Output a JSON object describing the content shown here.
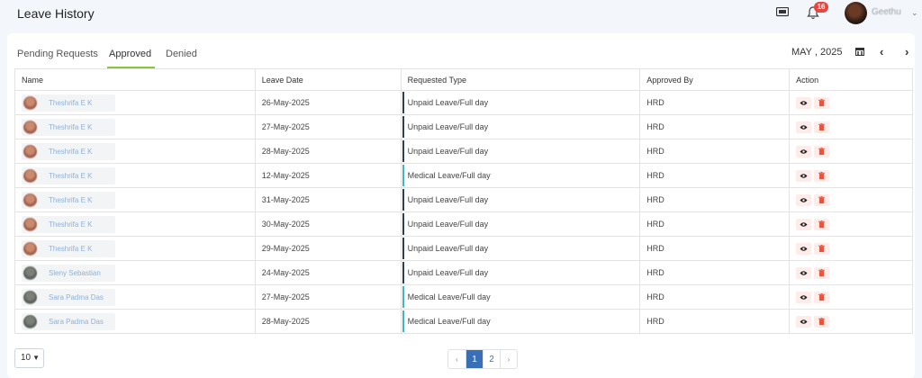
{
  "header": {
    "title": "Leave History",
    "notification_count": "16",
    "user_name": "Geethu"
  },
  "tabs": [
    {
      "label": "Pending Requests",
      "active": false
    },
    {
      "label": "Approved",
      "active": true
    },
    {
      "label": "Denied",
      "active": false
    }
  ],
  "period": {
    "label": "MAY , 2025"
  },
  "table": {
    "columns": [
      "Name",
      "Leave Date",
      "Requested Type",
      "Approved By",
      "Action"
    ],
    "rows": [
      {
        "name": "Theshrifa E K",
        "date": "26-May-2025",
        "type": "Unpaid Leave/Full day",
        "approved_by": "HRD"
      },
      {
        "name": "Theshrifa E K",
        "date": "27-May-2025",
        "type": "Unpaid Leave/Full day",
        "approved_by": "HRD"
      },
      {
        "name": "Theshrifa E K",
        "date": "28-May-2025",
        "type": "Unpaid Leave/Full day",
        "approved_by": "HRD"
      },
      {
        "name": "Theshrifa E K",
        "date": "12-May-2025",
        "type": "Medical Leave/Full day",
        "approved_by": "HRD"
      },
      {
        "name": "Theshrifa E K",
        "date": "31-May-2025",
        "type": "Unpaid Leave/Full day",
        "approved_by": "HRD"
      },
      {
        "name": "Theshrifa E K",
        "date": "30-May-2025",
        "type": "Unpaid Leave/Full day",
        "approved_by": "HRD"
      },
      {
        "name": "Theshrifa E K",
        "date": "29-May-2025",
        "type": "Unpaid Leave/Full day",
        "approved_by": "HRD"
      },
      {
        "name": "Sleny Sebastian",
        "date": "24-May-2025",
        "type": "Unpaid Leave/Full day",
        "approved_by": "HRD"
      },
      {
        "name": "Sara Padma Das",
        "date": "27-May-2025",
        "type": "Medical Leave/Full day",
        "approved_by": "HRD"
      },
      {
        "name": "Sara Padma Das",
        "date": "28-May-2025",
        "type": "Medical Leave/Full day",
        "approved_by": "HRD"
      }
    ]
  },
  "footer": {
    "page_size": "10",
    "pages": [
      "1",
      "2"
    ],
    "current_page": "1",
    "prev_label": "‹",
    "next_label": "›"
  },
  "colors": {
    "tab_underline": "#8dc341",
    "unpaid_bar": "#2e3f52",
    "medical_bar": "#3fb6c2",
    "action_bg": "#fdecea",
    "pager_active": "#3a6fb5",
    "badge": "#e8453c"
  },
  "icons": {
    "screen": "monitor-icon",
    "notifications": "bell-icon",
    "calendar": "calendar-icon",
    "view": "eye-icon",
    "delete": "trash-icon"
  }
}
